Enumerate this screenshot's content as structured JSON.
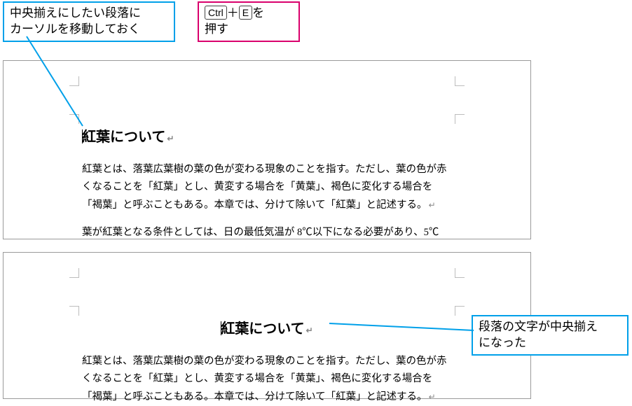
{
  "callouts": {
    "top_left": "中央揃えにしたい段落に\nカーソルを移動しておく",
    "top_right_prefix": "",
    "key1": "Ctrl",
    "key_plus": "＋",
    "key2": "E",
    "top_right_suffix1": "を",
    "top_right_suffix2": "押す",
    "bottom_right": "段落の文字が中央揃え\nになった"
  },
  "document": {
    "title": "紅葉について",
    "body_p1": "紅葉とは、落葉広葉樹の葉の色が変わる現象のことを指す。ただし、葉の色が赤くなることを「紅葉」とし、黄変する場合を「黄葉」、褐色に変化する場合を「褐葉」と呼ぶこともある。本章では、分けて除いて「紅葉」と記述する。",
    "body_p2": "葉が紅葉となる条件としては、日の最低気温が 8℃以下になる必要があり、5℃"
  }
}
